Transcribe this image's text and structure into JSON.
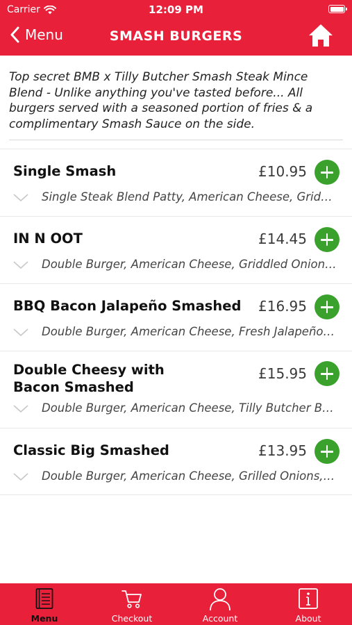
{
  "status_bar": {
    "carrier": "Carrier",
    "time": "12:09 PM"
  },
  "nav": {
    "back_label": "Menu",
    "title": "SMASH BURGERS"
  },
  "intro": "Top secret BMB x Tilly Butcher Smash Steak Mince Blend - Unlike anything you've tasted before... All burgers served with a seasoned portion of fries & a complimentary Smash Sauce on the side.",
  "items": [
    {
      "name": "Single Smash",
      "price": "£10.95",
      "description": "Single Steak Blend Patty, American Cheese, Griddled Onions, Pickles"
    },
    {
      "name": "IN N OOT",
      "price": "£14.45",
      "description": "Double Burger, American Cheese, Griddled Onions, Pickles"
    },
    {
      "name": "BBQ Bacon Jalapeño Smashed",
      "price": "£16.95",
      "description": "Double Burger, American Cheese, Fresh Jalapeños, Bacon"
    },
    {
      "name": "Double Cheesy with Bacon Smashed",
      "price": "£15.95",
      "description": "Double Burger, American Cheese, Tilly Butcher Bacon"
    },
    {
      "name": "Classic Big Smashed",
      "price": "£13.95",
      "description": "Double Burger, American Cheese, Grilled Onions, Pickles"
    }
  ],
  "tabs": [
    {
      "label": "Menu",
      "icon": "menu-book-icon",
      "active": true
    },
    {
      "label": "Checkout",
      "icon": "cart-icon",
      "active": false
    },
    {
      "label": "Account",
      "icon": "user-icon",
      "active": false
    },
    {
      "label": "About",
      "icon": "info-icon",
      "active": false
    }
  ],
  "colors": {
    "brand_red": "#e8203a",
    "add_green": "#3aa22c",
    "active_tab_text": "#111111"
  }
}
